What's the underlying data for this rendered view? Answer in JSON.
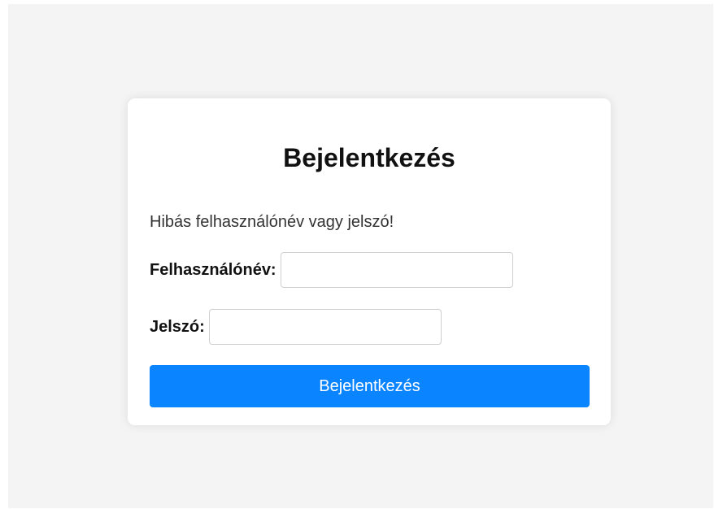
{
  "login": {
    "title": "Bejelentkezés",
    "error_message": "Hibás felhasználónév vagy jelszó!",
    "username_label": "Felhasználónév:",
    "username_value": "",
    "password_label": "Jelszó:",
    "password_value": "",
    "submit_label": "Bejelentkezés"
  },
  "colors": {
    "page_background": "#f4f4f4",
    "card_background": "#ffffff",
    "button_primary": "#0a84ff",
    "button_text": "#ffffff"
  }
}
